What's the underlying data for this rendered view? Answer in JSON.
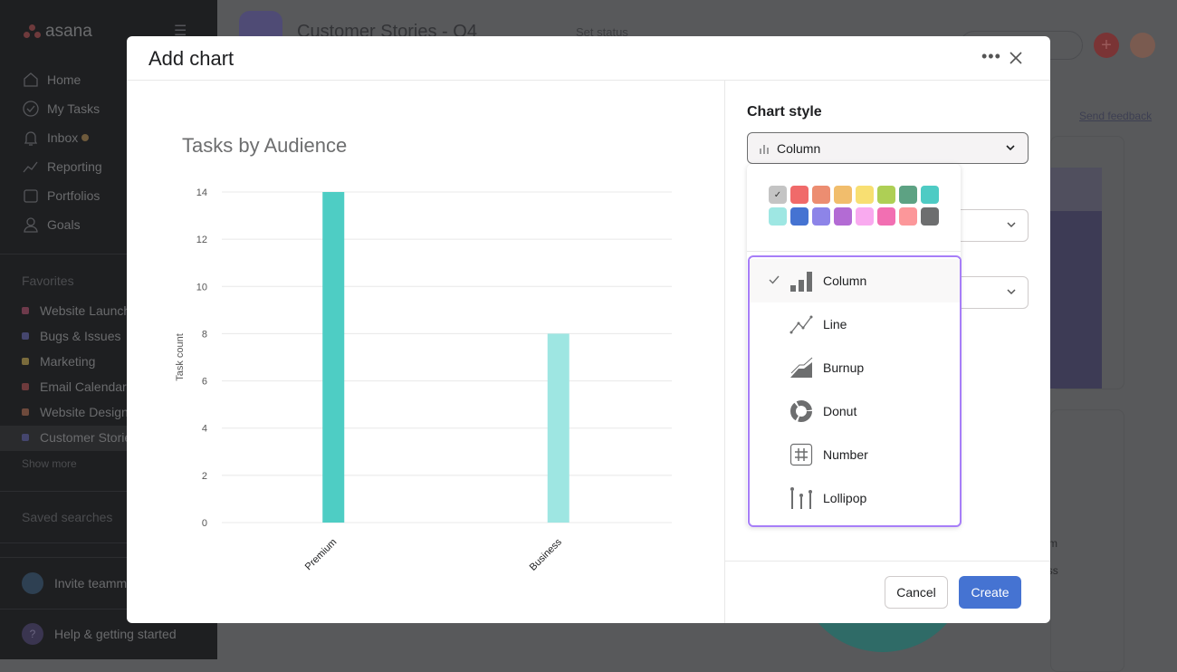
{
  "sidebar": {
    "logo": "asana",
    "nav": [
      {
        "label": "Home",
        "icon": "home-icon"
      },
      {
        "label": "My Tasks",
        "icon": "check-circle-icon"
      },
      {
        "label": "Inbox",
        "icon": "bell-icon"
      },
      {
        "label": "Reporting",
        "icon": "reporting-icon"
      },
      {
        "label": "Portfolios",
        "icon": "portfolio-icon"
      },
      {
        "label": "Goals",
        "icon": "goals-icon"
      }
    ],
    "favorites_label": "Favorites",
    "favorites": [
      {
        "label": "Website Launch",
        "color": "#6e3a4b"
      },
      {
        "label": "Bugs & Issues",
        "color": "#45466e"
      },
      {
        "label": "Marketing",
        "color": "#7a6b3c"
      },
      {
        "label": "Email Calendar",
        "color": "#6e3a3c"
      },
      {
        "label": "Website Design",
        "color": "#6e4a3c"
      },
      {
        "label": "Customer Stories",
        "color": "#45466e"
      }
    ],
    "show_more": "Show more",
    "saved_searches": "Saved searches",
    "invite": "Invite teammates",
    "help": "Help & getting started"
  },
  "header": {
    "project_title": "Customer Stories - Q4",
    "set_status": "Set status",
    "send_feedback": "Send feedback"
  },
  "background_legend": [
    "Premium",
    "Business"
  ],
  "modal": {
    "title": "Add chart",
    "cancel": "Cancel",
    "create": "Create",
    "chart_style_label": "Chart style",
    "chart_style_value": "Column",
    "swatches": [
      "#c4c4c4",
      "#f06a6a",
      "#ec8d71",
      "#f1bd6c",
      "#f8df72",
      "#aecf55",
      "#5da283",
      "#4ecbc4",
      "#9ee7e3",
      "#4573d2",
      "#8d84e8",
      "#b36bd4",
      "#f9aaef",
      "#f26fb2",
      "#fc979a",
      "#6d6e6f"
    ],
    "selected_swatch": 0,
    "options": [
      {
        "label": "Column",
        "icon": "column-chart-icon",
        "selected": true
      },
      {
        "label": "Line",
        "icon": "line-chart-icon"
      },
      {
        "label": "Burnup",
        "icon": "burnup-chart-icon"
      },
      {
        "label": "Donut",
        "icon": "donut-chart-icon"
      },
      {
        "label": "Number",
        "icon": "number-icon"
      },
      {
        "label": "Lollipop",
        "icon": "lollipop-chart-icon"
      }
    ]
  },
  "chart_data": {
    "type": "bar",
    "title": "Tasks by Audience",
    "xlabel": "",
    "ylabel": "Task count",
    "categories": [
      "Premium",
      "Business"
    ],
    "values": [
      14,
      8
    ],
    "colors": [
      "#4ecdc4",
      "#9ee6e2"
    ],
    "ylim": [
      0,
      14
    ],
    "yticks": [
      0,
      2,
      4,
      6,
      8,
      10,
      12,
      14
    ],
    "grid": true
  }
}
